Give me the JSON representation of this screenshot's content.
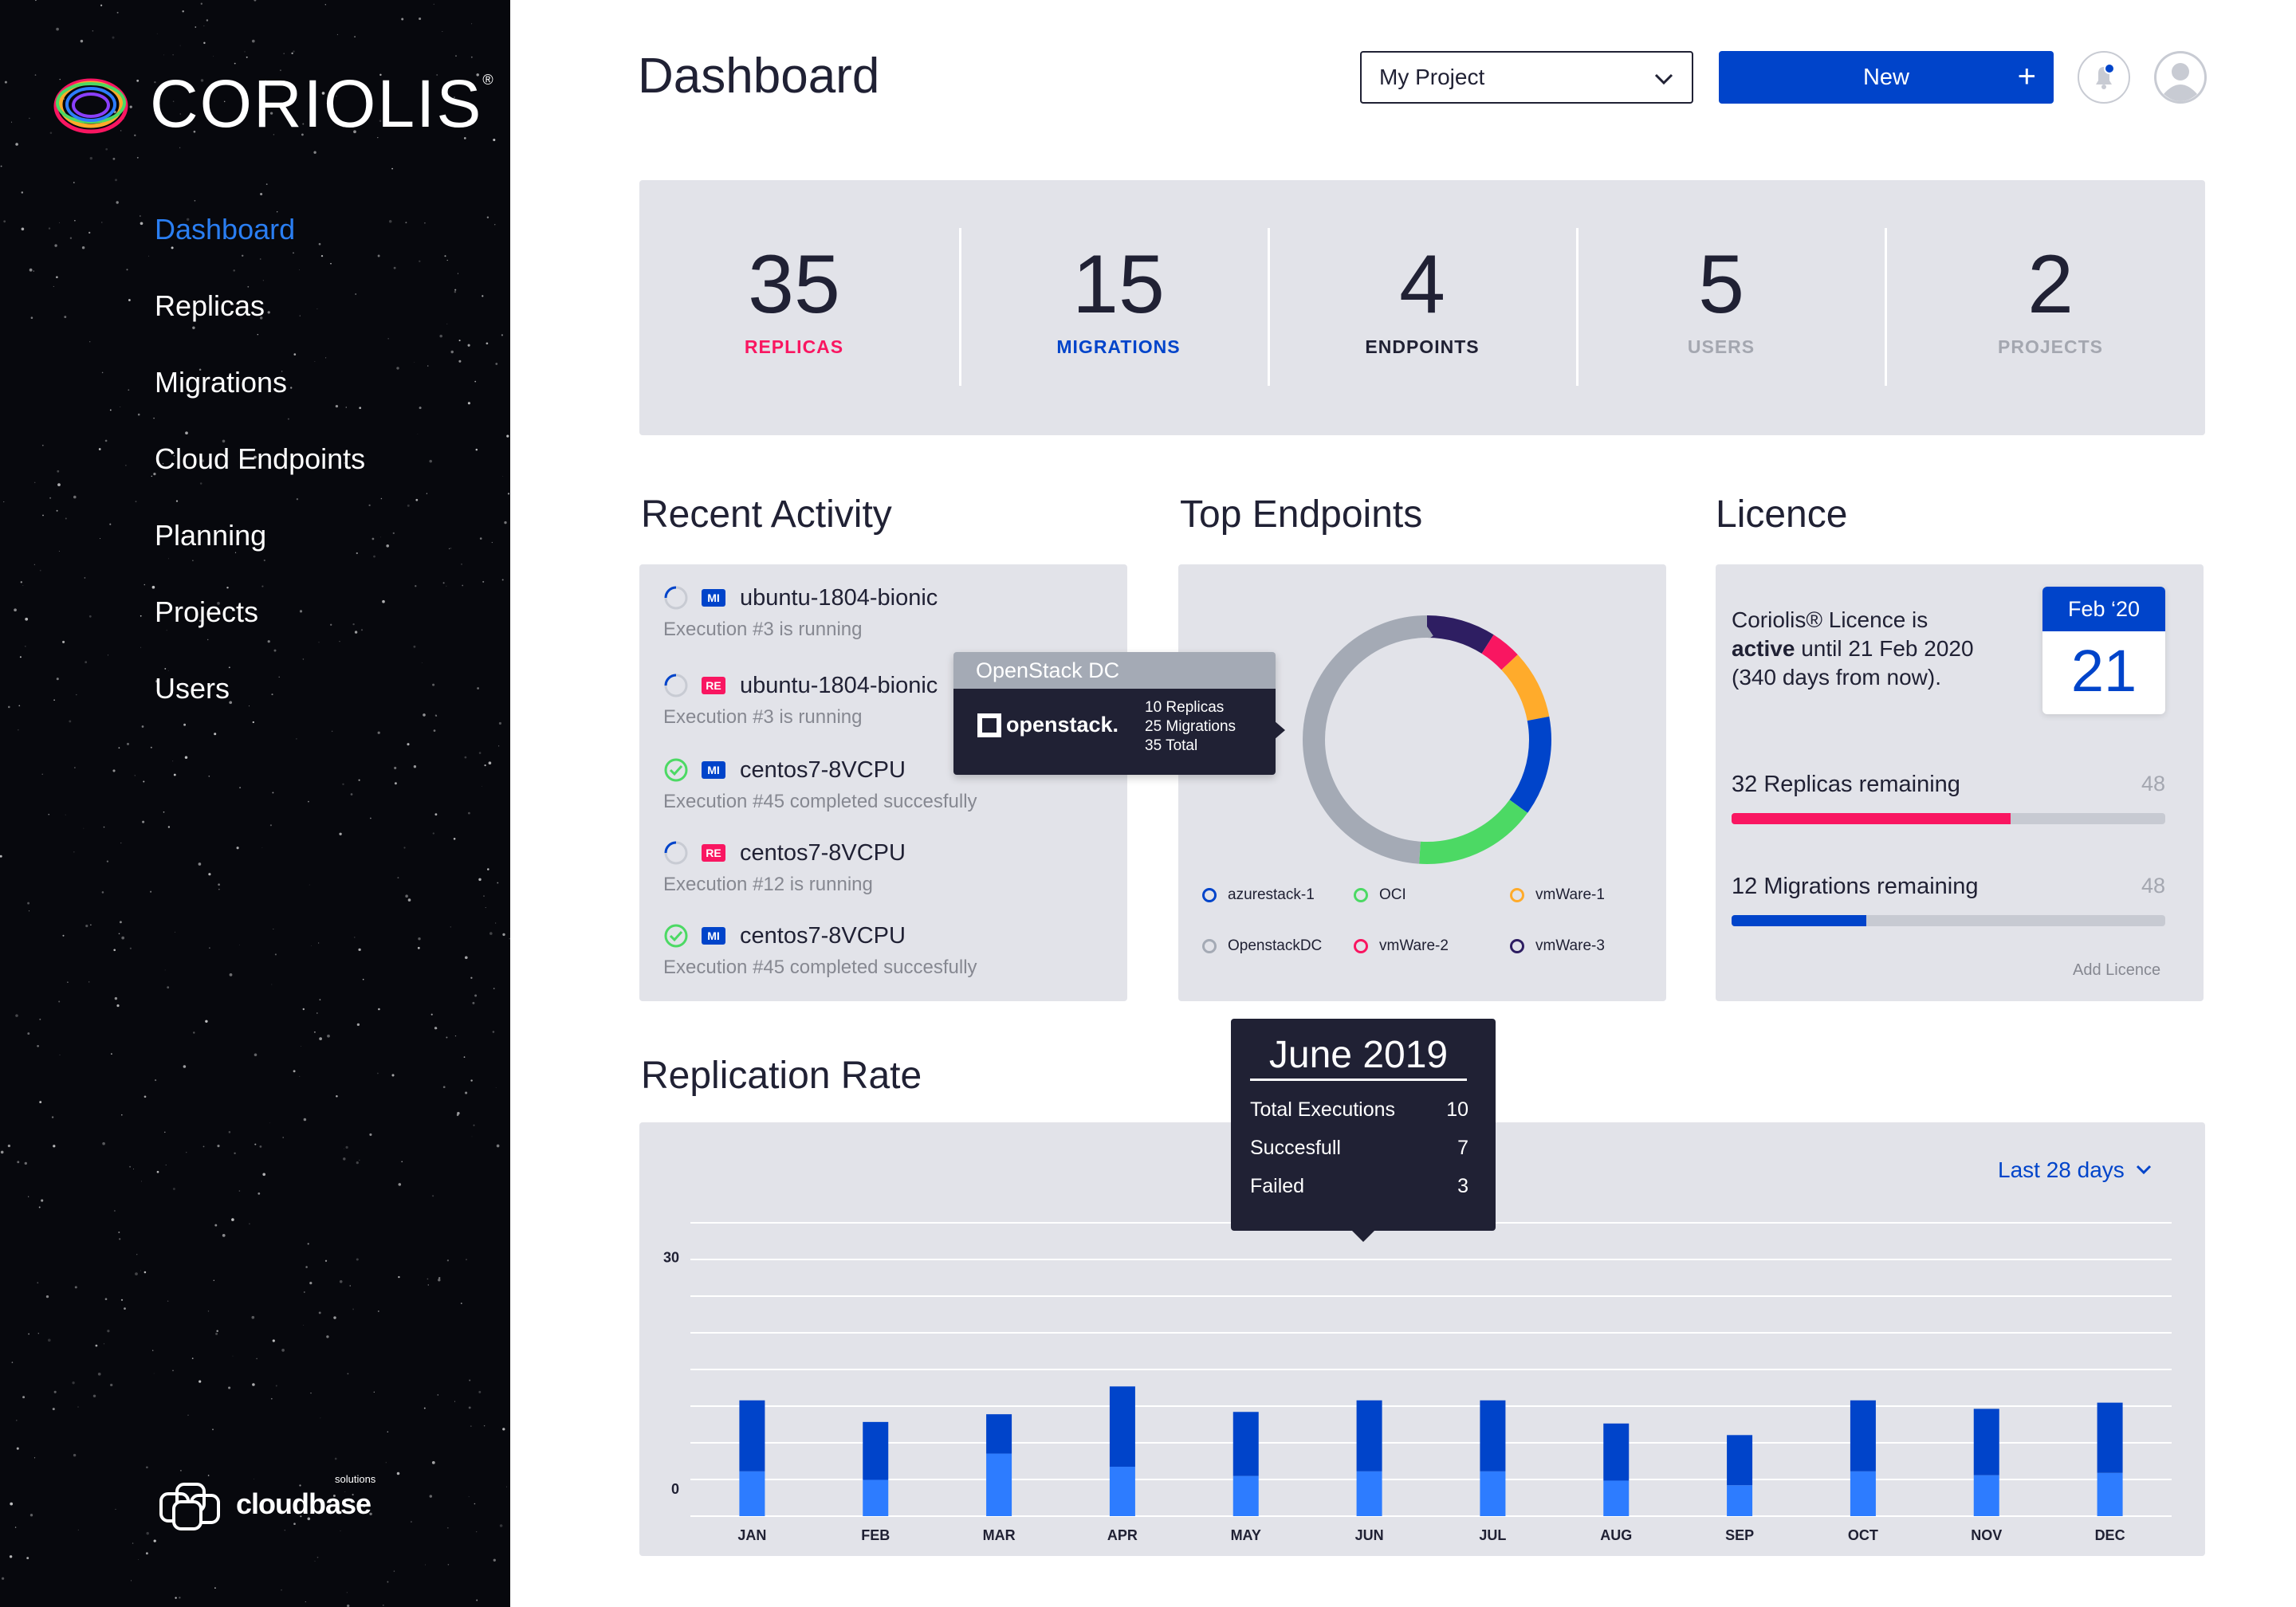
{
  "sidebar": {
    "brand": "CORIOLIS",
    "brand_mark": "®",
    "items": [
      {
        "label": "Dashboard",
        "active": true
      },
      {
        "label": "Replicas"
      },
      {
        "label": "Migrations"
      },
      {
        "label": "Cloud Endpoints"
      },
      {
        "label": "Planning"
      },
      {
        "label": "Projects"
      },
      {
        "label": "Users"
      }
    ],
    "footer_logo": {
      "text": "cloudbase",
      "sub": "solutions"
    }
  },
  "header": {
    "title": "Dashboard",
    "project_select": {
      "value": "My Project"
    },
    "new_button": {
      "label": "New",
      "icon": "plus-icon"
    },
    "notification_icon": "bell-icon",
    "avatar_icon": "user-avatar-icon"
  },
  "stats": [
    {
      "value": "35",
      "label": "REPLICAS",
      "color": "#f91661"
    },
    {
      "value": "15",
      "label": "MIGRATIONS",
      "color": "#0044ca"
    },
    {
      "value": "4",
      "label": "ENDPOINTS",
      "color": "#202134"
    },
    {
      "value": "5",
      "label": "USERS",
      "color": "#a4a7b0"
    },
    {
      "value": "2",
      "label": "PROJECTS",
      "color": "#a4a7b0"
    }
  ],
  "recent_activity": {
    "title": "Recent Activity",
    "items": [
      {
        "type": "MI",
        "status": "running",
        "name": "ubuntu-1804-bionic",
        "detail": "Execution #3 is running"
      },
      {
        "type": "RE",
        "status": "running",
        "name": "ubuntu-1804-bionic",
        "detail": "Execution #3 is running"
      },
      {
        "type": "MI",
        "status": "completed",
        "name": "centos7-8VCPU",
        "detail": "Execution #45 completed succesfully"
      },
      {
        "type": "RE",
        "status": "running",
        "name": "centos7-8VCPU",
        "detail": "Execution #12 is running"
      },
      {
        "type": "MI",
        "status": "completed",
        "name": "centos7-8VCPU",
        "detail": "Execution #45 completed succesfully"
      }
    ]
  },
  "top_endpoints": {
    "title": "Top Endpoints",
    "tooltip": {
      "title": "OpenStack DC",
      "logo_text": "openstack.",
      "lines": [
        "10 Replicas",
        "25 Migrations",
        "35 Total"
      ]
    },
    "legend": [
      {
        "name": "azurestack-1",
        "color": "#0044ca"
      },
      {
        "name": "OCI",
        "color": "#4cd964"
      },
      {
        "name": "vmWare-1",
        "color": "#ffab2b"
      },
      {
        "name": "OpenstackDC",
        "color": "#a4aab5"
      },
      {
        "name": "vmWare-2",
        "color": "#f91661"
      },
      {
        "name": "vmWare-3",
        "color": "#2e1e62"
      }
    ],
    "donut": [
      {
        "name": "vmWare-3",
        "value": 9,
        "color": "#2e1e62"
      },
      {
        "name": "vmWare-2",
        "value": 4,
        "color": "#f91661"
      },
      {
        "name": "vmWare-1",
        "value": 9,
        "color": "#ffab2b"
      },
      {
        "name": "azurestack-1",
        "value": 13,
        "color": "#0044ca"
      },
      {
        "name": "OCI",
        "value": 16,
        "color": "#4cd964"
      },
      {
        "name": "OpenstackDC",
        "value": 49,
        "color": "#a4aab5"
      }
    ]
  },
  "licence": {
    "title": "Licence",
    "text_prefix": "Coriolis® Licence is",
    "text_bold": "active",
    "text_until": "until 21 Feb 2020",
    "text_days": "(340 days from now).",
    "calendar": {
      "month": "Feb ‘20",
      "day": "21"
    },
    "replicas": {
      "label": "32 Replicas remaining",
      "max": "48",
      "progress": 0.644,
      "color": "#f91661"
    },
    "migrations": {
      "label": "12 Migrations remaining",
      "max": "48",
      "progress": 0.31,
      "color": "#0044ca"
    },
    "add_label": "Add Licence"
  },
  "replication_rate": {
    "title": "Replication Rate",
    "range": "Last 28 days",
    "tooltip": {
      "title": "June 2019",
      "rows": [
        {
          "label": "Total Executions",
          "value": "10"
        },
        {
          "label": "Succesfull",
          "value": "7"
        },
        {
          "label": "Failed",
          "value": "3"
        }
      ]
    }
  },
  "chart_data": {
    "type": "bar",
    "stacked": true,
    "categories": [
      "JAN",
      "FEB",
      "MAR",
      "APR",
      "MAY",
      "JUN",
      "JUL",
      "AUG",
      "SEP",
      "OCT",
      "NOV",
      "DEC"
    ],
    "y_ticks": [
      "30",
      "0"
    ],
    "series": [
      {
        "color": "#2d7cff",
        "values": [
          5.8,
          4.7,
          8.1,
          6.4,
          5.2,
          5.8,
          5.8,
          4.6,
          4.0,
          5.8,
          5.3,
          5.6
        ]
      },
      {
        "color": "#0044ca",
        "values": [
          9.2,
          7.5,
          5.1,
          10.4,
          8.3,
          9.2,
          9.2,
          7.4,
          6.5,
          9.2,
          8.6,
          9.1
        ]
      }
    ],
    "ylim": [
      -3.5,
      34.5
    ],
    "grid": true
  }
}
